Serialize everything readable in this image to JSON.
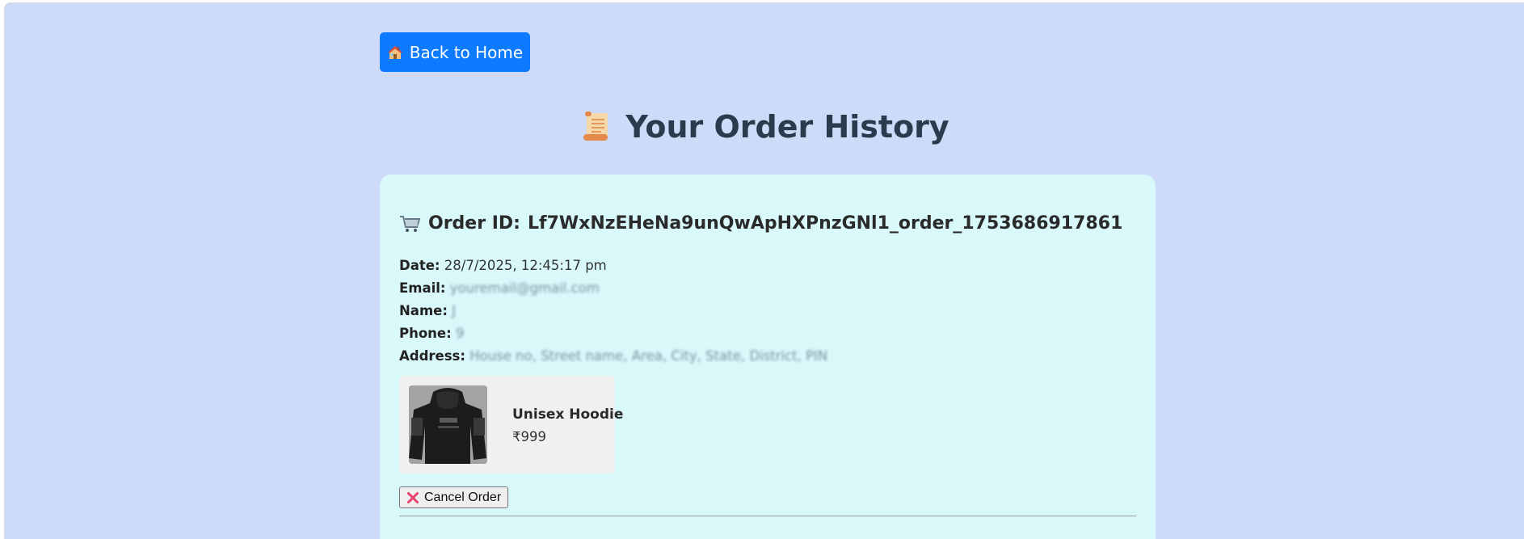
{
  "header": {
    "back_button_label": "Back to Home",
    "back_button_icon": "house-icon"
  },
  "page": {
    "title": "Your Order History",
    "title_icon": "scroll-icon",
    "background_color": "#cddaf8",
    "accent_color": "#0d7bff"
  },
  "order": {
    "heading_icon": "shopping-cart-icon",
    "id_label": "Order ID:",
    "id_value": "Lf7WxNzEHeNa9unQwApHXPnzGNl1_order_1753686917861",
    "date_label": "Date:",
    "date_value": "28/7/2025, 12:45:17 pm",
    "email_label": "Email:",
    "email_value": "youremail@gmail.com",
    "name_label": "Name:",
    "name_value": "J",
    "phone_label": "Phone:",
    "phone_value": "9",
    "address_label": "Address:",
    "address_value": "House no, Street name, Area, City, State, District, PIN",
    "card_color": "#d8f8fa",
    "items": [
      {
        "name": "Unisex Hoodie",
        "price": "₹999",
        "image": "black-hoodie-image"
      }
    ],
    "cancel_button_label": "Cancel Order",
    "cancel_button_icon": "x-icon"
  }
}
